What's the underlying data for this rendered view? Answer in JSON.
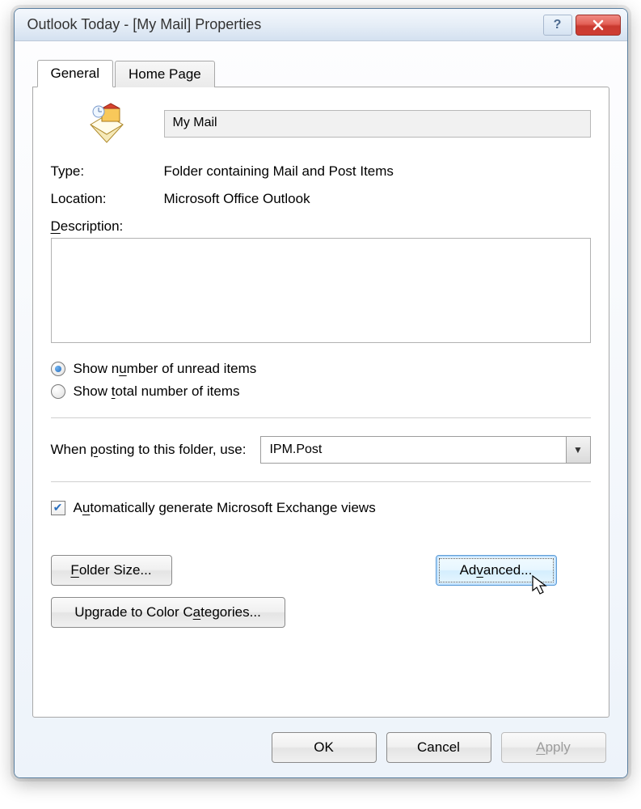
{
  "title": "Outlook Today - [My Mail] Properties",
  "tabs": {
    "general": "General",
    "homepage": "Home Page"
  },
  "fields": {
    "nameValue": "My Mail",
    "typeLabel": "Type:",
    "typeValue": "Folder containing Mail and Post Items",
    "locationLabel": "Location:",
    "locationValue": "Microsoft Office Outlook",
    "descriptionLabelPre": "D",
    "descriptionLabelPost": "escription:",
    "descriptionValue": ""
  },
  "radios": {
    "unreadPre": "Show n",
    "unreadMid": "u",
    "unreadPost": "mber of unread items",
    "totalPre": "Show ",
    "totalMid": "t",
    "totalPost": "otal number of items",
    "selected": "unread"
  },
  "posting": {
    "labelPre": "When ",
    "labelMid": "p",
    "labelPost": "osting to this folder, use:",
    "value": "IPM.Post"
  },
  "checkbox": {
    "pre": "A",
    "mid": "u",
    "post": "tomatically generate Microsoft Exchange views",
    "checked": true
  },
  "buttons": {
    "folderSize": "Folder Size...",
    "upgradePre": "Upgrade to Color C",
    "upgradeMid": "a",
    "upgradePost": "tegories...",
    "advanced": "Advanced...",
    "ok": "OK",
    "cancel": "Cancel",
    "apply": "Apply"
  }
}
